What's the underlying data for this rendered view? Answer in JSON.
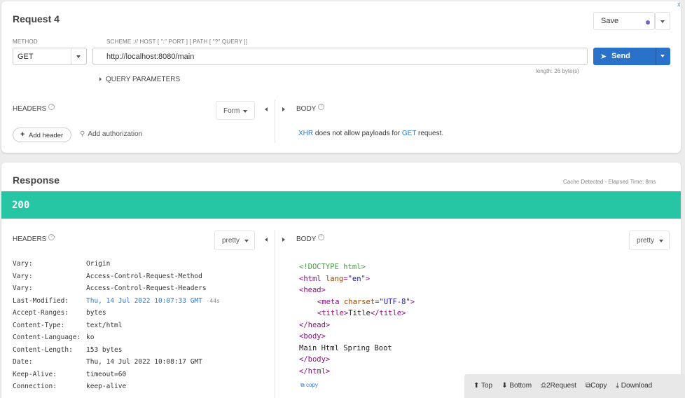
{
  "request": {
    "title": "Request 4",
    "save_label": "Save",
    "method_label": "METHOD",
    "method_value": "GET",
    "url_label": "SCHEME :// HOST [ \":\" PORT ] [ PATH [ \"?\" QUERY ]]",
    "url_value": "http://localhost:8080/main",
    "send_label": "Send",
    "length_text": "length: 26 byte(s)",
    "query_params_label": "QUERY PARAMETERS",
    "headers_label": "HEADERS",
    "form_label": "Form",
    "body_label": "BODY",
    "add_header_label": "Add header",
    "add_auth_label": "Add authorization",
    "body_msg_xhr": "XHR",
    "body_msg_mid": " does not allow payloads for ",
    "body_msg_get": "GET",
    "body_msg_end": " request.",
    "help_glyph": "?"
  },
  "response": {
    "title": "Response",
    "cache_text": "Cache Detected - Elapsed Time: 8ms",
    "status_code": "200",
    "headers_label": "HEADERS",
    "body_label": "BODY",
    "pretty_left": "pretty",
    "pretty_right": "pretty",
    "headers": [
      {
        "key": "Vary:",
        "value": "Origin"
      },
      {
        "key": "Vary:",
        "value": "Access-Control-Request-Method"
      },
      {
        "key": "Vary:",
        "value": "Access-Control-Request-Headers"
      },
      {
        "key": "Last-Modified:",
        "value": "Thu, 14 Jul 2022 10:07:33 GMT",
        "extra": "-44s"
      },
      {
        "key": "Accept-Ranges:",
        "value": "bytes"
      },
      {
        "key": "Content-Type:",
        "value": "text/html"
      },
      {
        "key": "Content-Language:",
        "value": "ko"
      },
      {
        "key": "Content-Length:",
        "value": "153 bytes"
      },
      {
        "key": "Date:",
        "value": "Thu, 14 Jul 2022 10:08:17 GMT"
      },
      {
        "key": "Keep-Alive:",
        "value": "timeout=60"
      },
      {
        "key": "Connection:",
        "value": "keep-alive"
      }
    ],
    "body_code": {
      "doctype": "<!DOCTYPE html>",
      "html_open_a": "<html ",
      "html_attr": "lang",
      "html_eq": "=",
      "html_val": "\"en\"",
      "html_close": ">",
      "head_open": "<head>",
      "meta_open": "<meta ",
      "meta_attr": "charset",
      "meta_eq": "=",
      "meta_val": "\"UTF-8\"",
      "meta_close": ">",
      "title_open": "<title>",
      "title_text": "Title",
      "title_close": "</title>",
      "head_close": "</head>",
      "body_open": "<body>",
      "body_text": "Main Html Spring Boot",
      "body_close": "</body>",
      "html_end": "</html>"
    },
    "copy_label": "copy"
  },
  "bottom_bar": {
    "top": "Top",
    "bottom": "Bottom",
    "to_request": "2Request",
    "copy": "Copy",
    "download": "Download"
  },
  "colors": {
    "status_green": "#26c6a4",
    "send_blue": "#2a71c9",
    "link_blue": "#2a7ad6"
  },
  "close_glyph": "x"
}
